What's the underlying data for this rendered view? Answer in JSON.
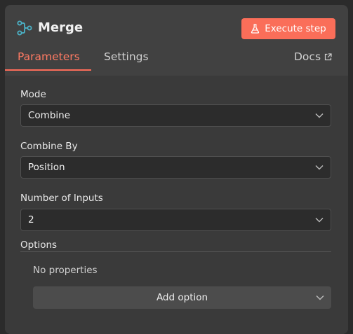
{
  "header": {
    "node_icon": "merge-icon",
    "title": "Merge",
    "execute_label": "Execute step",
    "execute_icon": "flask-icon"
  },
  "tabs": {
    "parameters": "Parameters",
    "settings": "Settings",
    "docs": "Docs",
    "docs_icon": "external-link-icon",
    "active": "Parameters"
  },
  "fields": {
    "mode": {
      "label": "Mode",
      "value": "Combine"
    },
    "combine_by": {
      "label": "Combine By",
      "value": "Position"
    },
    "number_of_inputs": {
      "label": "Number of Inputs",
      "value": "2"
    }
  },
  "options": {
    "label": "Options",
    "empty_text": "No properties",
    "add_label": "Add option"
  },
  "colors": {
    "accent": "#ff6d5a",
    "node_icon": "#4bb3c8"
  }
}
